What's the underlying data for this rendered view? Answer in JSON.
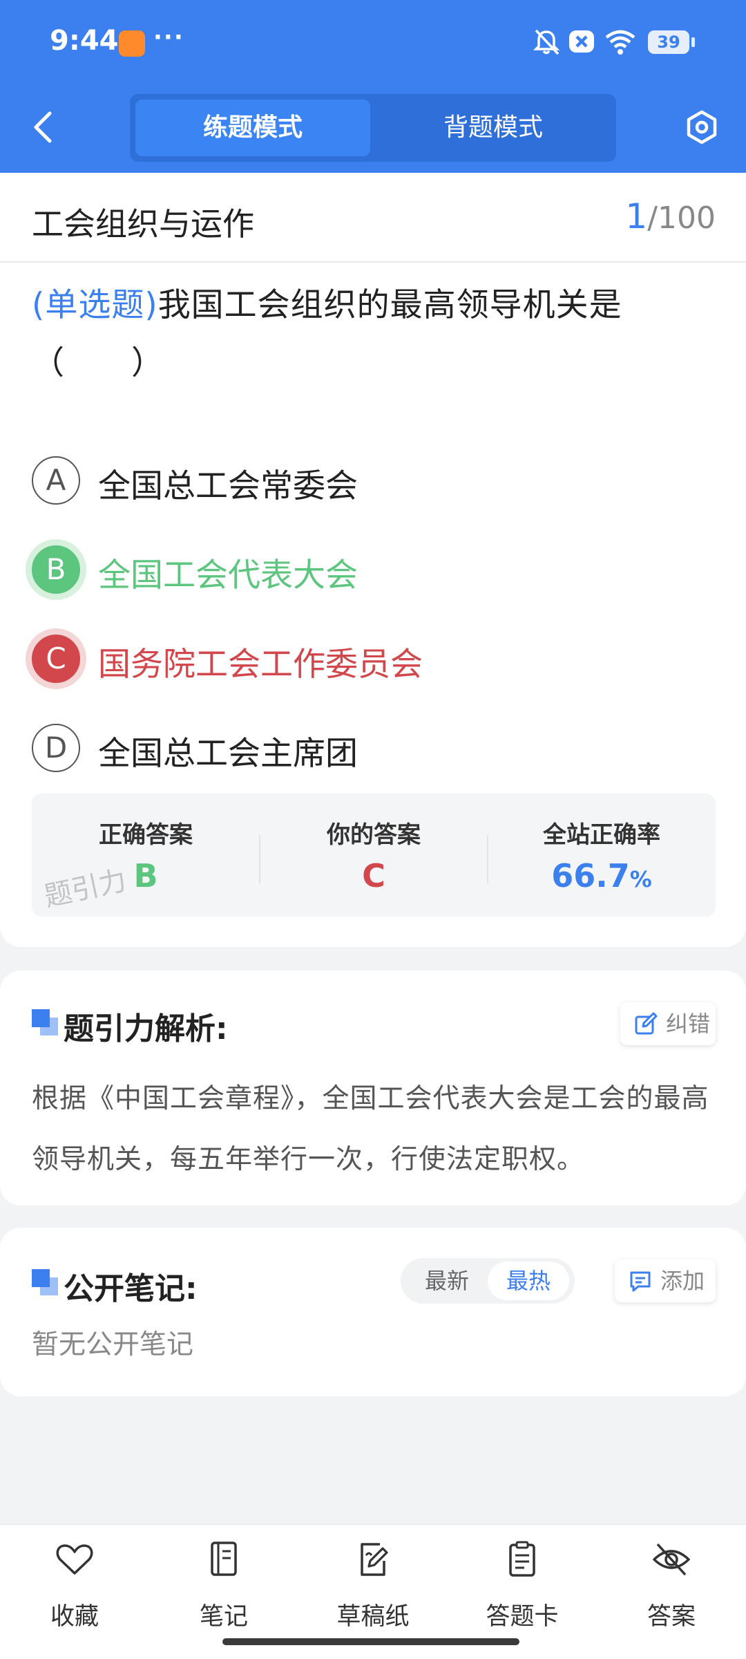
{
  "status_bar": {
    "time": "9:44",
    "dots": "···",
    "battery": "39"
  },
  "header": {
    "tabs": [
      {
        "label": "练题模式",
        "active": true
      },
      {
        "label": "背题模式",
        "active": false
      }
    ],
    "accent_color": "#3b80ee"
  },
  "question": {
    "section_title": "工会组织与运作",
    "current": "1",
    "total": "/100",
    "type_label": "(单选题)",
    "text": "我国工会组织的最高领导机关是（　　）",
    "options": [
      {
        "letter": "A",
        "text": "全国总工会常委会",
        "state": "normal"
      },
      {
        "letter": "B",
        "text": "全国工会代表大会",
        "state": "correct"
      },
      {
        "letter": "C",
        "text": "国务院工会工作委员会",
        "state": "wrong"
      },
      {
        "letter": "D",
        "text": "全国总工会主席团",
        "state": "normal"
      }
    ]
  },
  "stats": {
    "correct_label": "正确答案",
    "correct_value": "B",
    "yours_label": "你的答案",
    "yours_value": "C",
    "rate_label": "全站正确率",
    "rate_value": "66.7",
    "rate_unit": "%",
    "watermark": "题引力",
    "correct_color": "#5cc57e",
    "wrong_color": "#d2474b"
  },
  "analysis": {
    "title": "题引力解析:",
    "report_label": "纠错",
    "text": "根据《中国工会章程》，全国工会代表大会是工会的最高领导机关，每五年举行一次，行使法定职权。"
  },
  "notes": {
    "title": "公开笔记:",
    "sort_new": "最新",
    "sort_hot": "最热",
    "add_label": "添加",
    "empty_text": "暂无公开笔记"
  },
  "bottom_nav": [
    {
      "label": "收藏",
      "icon": "heart-icon"
    },
    {
      "label": "笔记",
      "icon": "notebook-icon"
    },
    {
      "label": "草稿纸",
      "icon": "draft-paper-icon"
    },
    {
      "label": "答题卡",
      "icon": "answer-sheet-icon"
    },
    {
      "label": "答案",
      "icon": "eye-off-icon"
    }
  ]
}
